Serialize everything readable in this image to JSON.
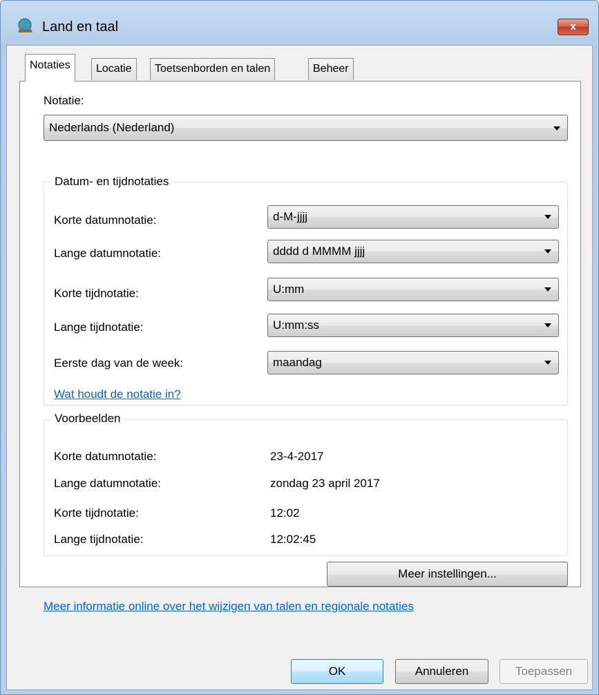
{
  "window": {
    "title": "Land en taal",
    "close_glyph": "x"
  },
  "tabs": [
    {
      "label": "Notaties",
      "active": true
    },
    {
      "label": "Locatie",
      "active": false
    },
    {
      "label": "Toetsenborden en talen",
      "active": false
    },
    {
      "label": "Beheer",
      "active": false
    }
  ],
  "notatie": {
    "label": "Notatie:",
    "value": "Nederlands (Nederland)"
  },
  "datetime_group": {
    "title": "Datum- en tijdnotaties",
    "rows": [
      {
        "label": "Korte datumnotatie:",
        "value": "d-M-jjjj"
      },
      {
        "label": "Lange datumnotatie:",
        "value": "dddd d MMMM jjjj"
      },
      {
        "label": "Korte tijdnotatie:",
        "value": "U:mm"
      },
      {
        "label": "Lange tijdnotatie:",
        "value": "U:mm:ss"
      },
      {
        "label": "Eerste dag van de week:",
        "value": "maandag"
      }
    ],
    "help_link": "Wat houdt de notatie in?"
  },
  "examples_group": {
    "title": "Voorbeelden",
    "rows": [
      {
        "label": "Korte datumnotatie:",
        "value": "23-4-2017"
      },
      {
        "label": "Lange datumnotatie:",
        "value": "zondag 23 april 2017"
      },
      {
        "label": "Korte tijdnotatie:",
        "value": "12:02"
      },
      {
        "label": "Lange tijdnotatie:",
        "value": "12:02:45"
      }
    ]
  },
  "more_settings_button": "Meer instellingen...",
  "info_link": "Meer informatie online over het wijzigen van talen en regionale notaties",
  "buttons": {
    "ok": "OK",
    "cancel": "Annuleren",
    "apply": "Toepassen"
  },
  "icons": {
    "title": "globe-icon",
    "dropdown": "chevron-down-icon"
  }
}
